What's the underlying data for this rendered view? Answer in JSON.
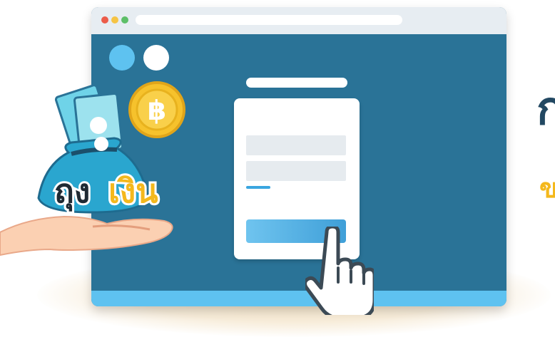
{
  "colors": {
    "window_bg": "#2a7397",
    "titlebar_bg": "#e7edf2",
    "accent_blue": "#5ec2f0",
    "traffic_red": "#ec5c4a",
    "traffic_yellow": "#f6c445",
    "traffic_green": "#5dbf68",
    "coin_gold": "#f6c22c",
    "brand_yellow": "#f4b81c",
    "heading_navy": "#224862"
  },
  "browser": {
    "traffic_lights": [
      "close",
      "minimize",
      "maximize"
    ]
  },
  "login_form": {
    "fields": [
      "field-1",
      "field-2"
    ],
    "submit_icon": "pointer-hand-icon"
  },
  "illustration": {
    "logo_text_black": "ถุง",
    "logo_text_yellow": "เงิน",
    "coin_symbol": "฿"
  },
  "side_heading": {
    "line1": "ก",
    "line2": "ข"
  }
}
